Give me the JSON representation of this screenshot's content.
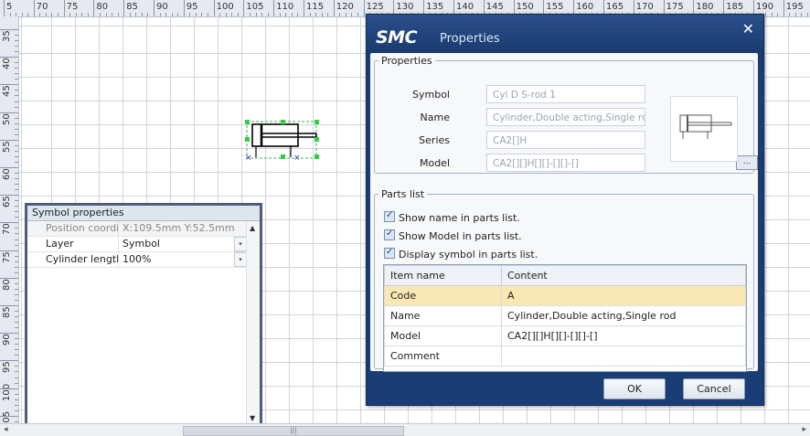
{
  "ruler": {
    "top_labels": [
      "5",
      "70",
      "75",
      "80",
      "85",
      "90",
      "95",
      "100",
      "105",
      "110",
      "115",
      "120",
      "125",
      "130",
      "135",
      "140",
      "145",
      "150",
      "155",
      "160",
      "165",
      "170",
      "175",
      "180",
      "185",
      "190",
      "195"
    ],
    "left_labels": [
      "35",
      "40",
      "45",
      "50",
      "55",
      "60",
      "65",
      "70",
      "75",
      "80",
      "85",
      "90",
      "95",
      "100",
      "105"
    ]
  },
  "scrollbar": {
    "left_arrow": "◂",
    "right_arrow": "▸",
    "grip": "|||"
  },
  "symbol_properties": {
    "title": "Symbol properties",
    "rows": [
      {
        "name": "Position coordinates",
        "value": "X:109.5mm Y:52.5mm"
      },
      {
        "name": "Layer",
        "value": "Symbol"
      },
      {
        "name": "Cylinder length",
        "value": "100%"
      }
    ],
    "dropdown_icon": "▾",
    "scroll_up": "▲",
    "scroll_down": "▼"
  },
  "dialog": {
    "brand": "SMC",
    "title": "Properties",
    "close_icon": "✕",
    "properties_group": "Properties",
    "fields": {
      "symbol_label": "Symbol",
      "symbol_value": "Cyl D S-rod 1",
      "name_label": "Name",
      "name_value": "Cylinder,Double acting,Single rod",
      "series_label": "Series",
      "series_value": "CA2[]H",
      "model_label": "Model",
      "model_value": "CA2[][]H[][]-[][]-[]",
      "browse_label": "..."
    },
    "parts_group": "Parts list",
    "checks": {
      "show_name": "Show name in parts list.",
      "show_model": "Show Model in parts list.",
      "display_symbol": "Display symbol in parts list."
    },
    "table": {
      "headers": [
        "Item name",
        "Content"
      ],
      "rows": [
        {
          "item": "Code",
          "content": "A"
        },
        {
          "item": "Name",
          "content": "Cylinder,Double acting,Single rod"
        },
        {
          "item": "Model",
          "content": "CA2[][]H[][]-[][]-[]"
        },
        {
          "item": "Comment",
          "content": ""
        }
      ]
    },
    "ok_label": "OK",
    "cancel_label": "Cancel"
  }
}
